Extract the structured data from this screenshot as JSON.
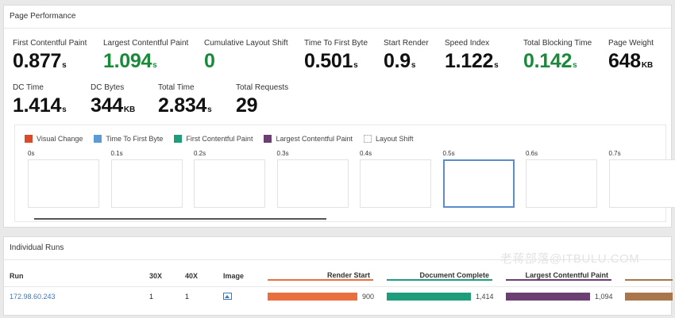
{
  "performance": {
    "title": "Page Performance",
    "metrics": [
      {
        "label": "First Contentful Paint",
        "value": "0.877",
        "unit": "s",
        "highlight": false
      },
      {
        "label": "Largest Contentful Paint",
        "value": "1.094",
        "unit": "s",
        "highlight": true
      },
      {
        "label": "Cumulative Layout Shift",
        "value": "0",
        "unit": "",
        "highlight": true
      },
      {
        "label": "Time To First Byte",
        "value": "0.501",
        "unit": "s",
        "highlight": false
      },
      {
        "label": "Start Render",
        "value": "0.9",
        "unit": "s",
        "highlight": false
      },
      {
        "label": "Speed Index",
        "value": "1.122",
        "unit": "s",
        "highlight": false
      },
      {
        "label": "Total Blocking Time",
        "value": "0.142",
        "unit": "s",
        "highlight": true
      },
      {
        "label": "Page Weight",
        "value": "648",
        "unit": "KB",
        "highlight": false
      },
      {
        "label": "DC Time",
        "value": "1.414",
        "unit": "s",
        "highlight": false
      },
      {
        "label": "DC Bytes",
        "value": "344",
        "unit": "KB",
        "highlight": false
      },
      {
        "label": "Total Time",
        "value": "2.834",
        "unit": "s",
        "highlight": false
      },
      {
        "label": "Total Requests",
        "value": "29",
        "unit": "",
        "highlight": false
      }
    ],
    "legend": [
      {
        "label": "Visual Change",
        "color": "#d94a2b"
      },
      {
        "label": "Time To First Byte",
        "color": "#5b9bd5"
      },
      {
        "label": "First Contentful Paint",
        "color": "#1f9c7a"
      },
      {
        "label": "Largest Contentful Paint",
        "color": "#6b3f72"
      },
      {
        "label": "Layout Shift",
        "color": "#ffffff"
      }
    ],
    "frames": [
      "0s",
      "0.1s",
      "0.2s",
      "0.3s",
      "0.4s",
      "0.5s",
      "0.6s",
      "0.7s"
    ],
    "active_frame": "0.5s"
  },
  "runs": {
    "title": "Individual Runs",
    "watermark": "老蒋部落@ITBULU.COM",
    "headers": {
      "run": "Run",
      "c30x": "30X",
      "c40x": "40X",
      "image": "Image",
      "render_start": "Render Start",
      "document_complete": "Document Complete",
      "lcp": "Largest Contentful Paint"
    },
    "colors": {
      "render_start": "#e8703f",
      "document_complete": "#1f9c7a",
      "lcp": "#6b3f72",
      "extra": "#a8764a",
      "link": "#3b78c2"
    },
    "rows": [
      {
        "run": "172.98.60.243",
        "c30x": "1",
        "c40x": "1",
        "image": "image-icon",
        "render_start": "900",
        "document_complete": "1,414",
        "lcp": "1,094"
      }
    ]
  }
}
